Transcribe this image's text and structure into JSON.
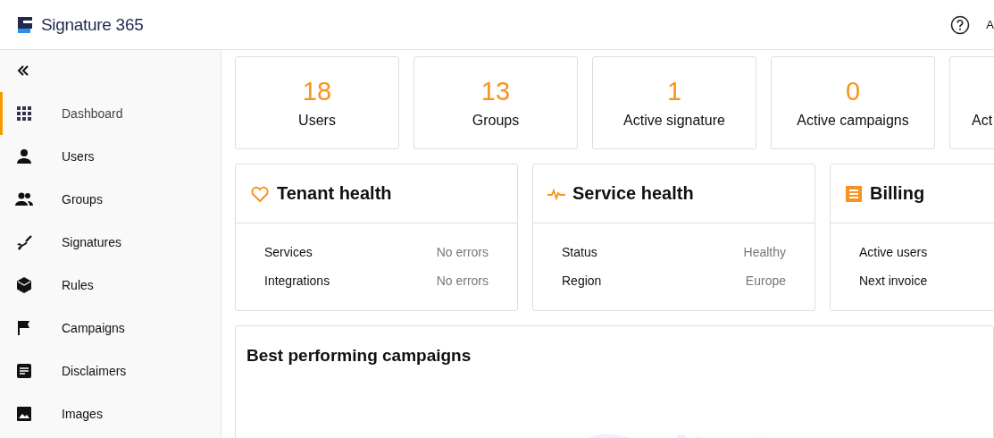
{
  "header": {
    "brand": "Signature 365",
    "user_initial": "A"
  },
  "sidebar": {
    "items": [
      {
        "label": "Dashboard",
        "selected": true
      },
      {
        "label": "Users",
        "selected": false
      },
      {
        "label": "Groups",
        "selected": false
      },
      {
        "label": "Signatures",
        "selected": false
      },
      {
        "label": "Rules",
        "selected": false
      },
      {
        "label": "Campaigns",
        "selected": false
      },
      {
        "label": "Disclaimers",
        "selected": false
      },
      {
        "label": "Images",
        "selected": false
      }
    ]
  },
  "stats": [
    {
      "value": "18",
      "label": "Users"
    },
    {
      "value": "13",
      "label": "Groups"
    },
    {
      "value": "1",
      "label": "Active signature"
    },
    {
      "value": "0",
      "label": "Active campaigns"
    },
    {
      "label": "Act"
    }
  ],
  "health_cards": [
    {
      "title": "Tenant health",
      "rows": [
        {
          "label": "Services",
          "value": "No errors"
        },
        {
          "label": "Integrations",
          "value": "No errors"
        }
      ]
    },
    {
      "title": "Service health",
      "rows": [
        {
          "label": "Status",
          "value": "Healthy"
        },
        {
          "label": "Region",
          "value": "Europe"
        }
      ]
    },
    {
      "title": "Billing",
      "rows": [
        {
          "label": "Active users"
        },
        {
          "label": "Next invoice"
        }
      ]
    }
  ],
  "campaigns": {
    "title": "Best performing campaigns"
  }
}
